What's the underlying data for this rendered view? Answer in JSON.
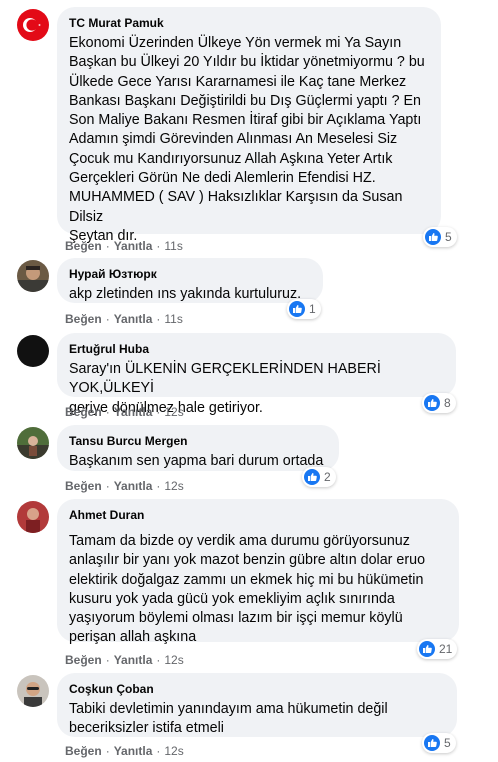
{
  "labels": {
    "like": "Beğen",
    "reply": "Yanıtla",
    "dot": "·"
  },
  "colors": {
    "bubble": "#f0f2f5",
    "like_blue": "#1877f2",
    "meta_gray": "#65676b"
  },
  "comments": [
    {
      "author": "TC Murat Pamuk",
      "avatar_icon": "turkish-flag-avatar",
      "text": "Ekonomi Üzerinden Ülkeye Yön vermek mi Ya Sayın\nBaşkan bu Ülkeyi 20 Yıldır bu İktidar yönetmiyormu ? bu\nÜlkede Gece Yarısı Kararnamesi ile Kaç tane Merkez\nBankası Başkanı Değiştirildi bu Dış Güçlermi yaptı ? En\nSon Maliye Bakanı Resmen İtiraf gibi bir Açıklama Yaptı\nAdamın şimdi Görevinden Alınması An Meselesi Siz\nÇocuk mu Kandırıyorsunuz Allah Aşkına Yeter Artık\nGerçekleri Görün Ne dedi Alemlerin Efendisi HZ.\nMUHAMMED ( SAV ) Haksızlıklar Karşısın da Susan Dilsiz\nŞeytan dır.",
      "time": "11s",
      "likes": "5"
    },
    {
      "author": "Нурай Юзтюрк",
      "avatar_icon": "man-photo-avatar",
      "text": "akp zletinden ıns yakında kurtuluruz.",
      "time": "11s",
      "likes": "1"
    },
    {
      "author": "Ertuğrul Huba",
      "avatar_icon": "black-circle-avatar",
      "text": "Saray'ın ÜLKENİN GERÇEKLERİNDEN HABERİ YOK,ÜLKEYİ\ngeriye dönülmez hale getiriyor.",
      "time": "12s",
      "likes": "8"
    },
    {
      "author": "Tansu Burcu Mergen",
      "avatar_icon": "outdoor-photo-avatar",
      "text": "Başkanım sen yapma bari durum ortada",
      "time": "12s",
      "likes": "2"
    },
    {
      "author": "Ahmet Duran",
      "avatar_icon": "red-photo-avatar",
      "text": "Tamam da bizde oy verdik ama durumu görüyorsunuz\nanlaşılır bir yanı yok mazot benzin gübre altın dolar eruo\nelektirik doğalgaz zammı un ekmek hiç mi bu hükümetin\nkusuru yok yada gücü yok emekliyim açlık sınırında\nyaşıyorum böylemi olması lazım bir işçi memur köylü\nperişan allah aşkına",
      "time": "12s",
      "likes": "21"
    },
    {
      "author": "Coşkun Çoban",
      "avatar_icon": "man-sunglasses-avatar",
      "text": "Tabiki devletimin yanındayım ama hükumetin değil\nbeceriksizler istifa etmeli",
      "time": "12s",
      "likes": "5"
    }
  ]
}
